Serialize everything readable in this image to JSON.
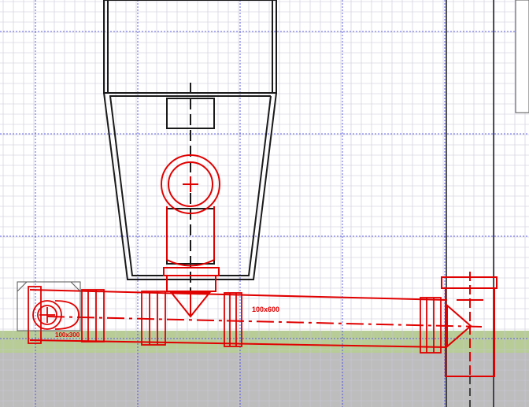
{
  "drawing": {
    "labels": {
      "pipe_long": "100x600",
      "pipe_short": "100x300"
    }
  },
  "colors": {
    "background": "#ffffff",
    "grid_minor": "#c8c8d8",
    "grid_major": "#3a3ae0",
    "soil_band": "#b7cc96",
    "concrete_band": "#bdbdbd",
    "structure_stroke": "#1a1a1a",
    "pipe_stroke": "#e00000"
  }
}
